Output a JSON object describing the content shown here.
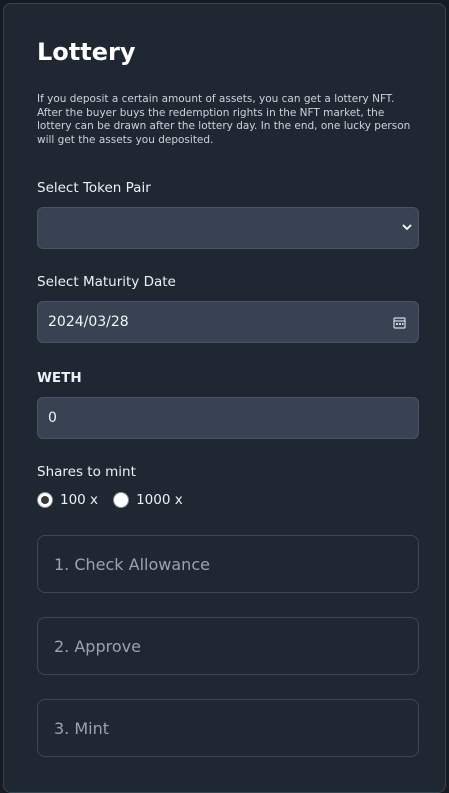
{
  "app": {
    "title": "Lottery",
    "description": "If you deposit a certain amount of assets, you can get a lottery NFT. After the buyer buys the redemption rights in the NFT market, the lottery can be drawn after the lottery day. In the end, one lucky person will get the assets you deposited."
  },
  "form": {
    "token_pair": {
      "label": "Select Token Pair",
      "value": "",
      "icon": "chevron-down-icon"
    },
    "maturity": {
      "label": "Select Maturity Date",
      "value": "2024/03/28",
      "icon": "calendar-icon"
    },
    "amount": {
      "label": "WETH",
      "value": "0"
    },
    "shares": {
      "label": "Shares to mint",
      "options": [
        {
          "label": "100 x",
          "checked": true
        },
        {
          "label": "1000 x",
          "checked": false
        }
      ]
    }
  },
  "steps": {
    "check": "1. Check Allowance",
    "approve": "2. Approve",
    "mint": "3. Mint"
  },
  "colors": {
    "background": "#161b22",
    "card": "#1f2733",
    "field": "#384252",
    "muted_text": "#9aa3ae"
  }
}
